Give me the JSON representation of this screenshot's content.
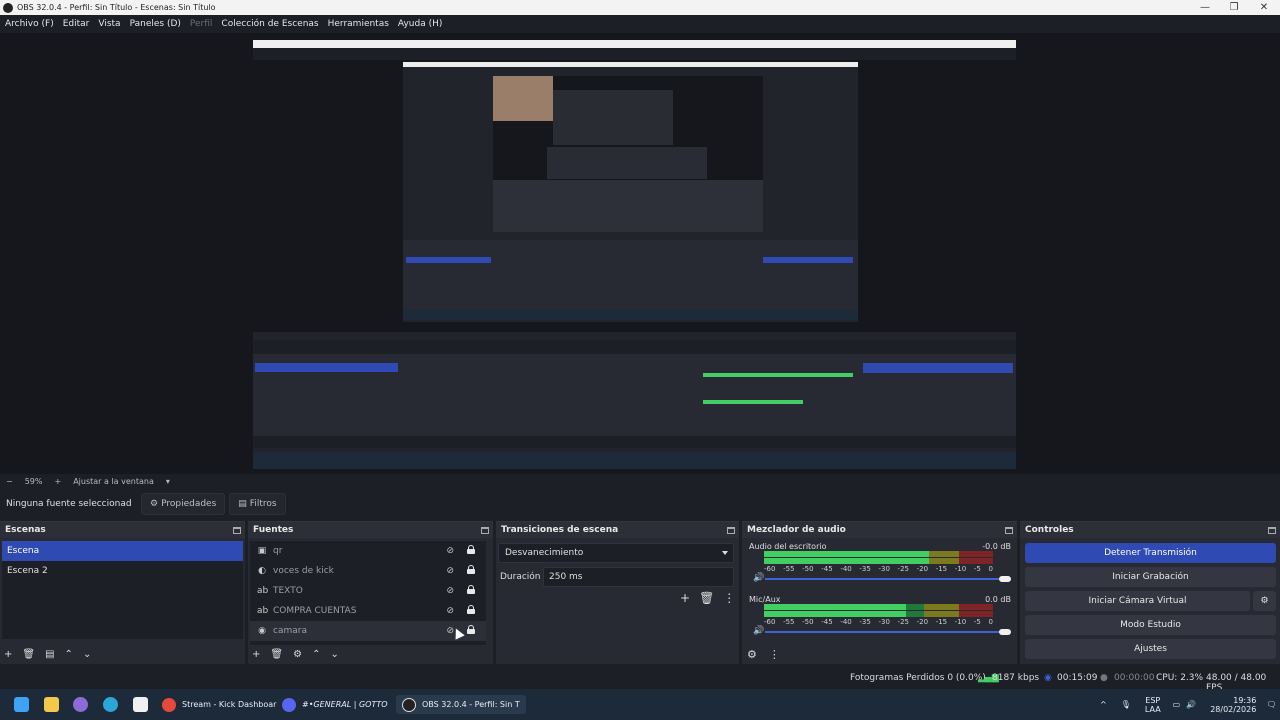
{
  "window": {
    "title": "OBS 32.0.4 - Perfil: Sin Título - Escenas: Sin Título"
  },
  "menu": [
    "Archivo (F)",
    "Editar",
    "Vista",
    "Paneles (D)",
    "Perfil",
    "Colección de Escenas",
    "Herramientas",
    "Ayuda (H)"
  ],
  "zoom": {
    "value": "59%",
    "fit_label": "Ajustar a la ventana"
  },
  "source_toolbar": {
    "no_selection": "Ninguna fuente seleccionad",
    "properties": "Propiedades",
    "filters": "Filtros"
  },
  "scenes": {
    "title": "Escenas",
    "items": [
      "Escena",
      "Escena 2"
    ],
    "selected": 0
  },
  "sources": {
    "title": "Fuentes",
    "items": [
      {
        "name": "qr",
        "icon": "image-icon"
      },
      {
        "name": "voces de kick",
        "icon": "browser-icon"
      },
      {
        "name": "TEXTO",
        "icon": "text-icon"
      },
      {
        "name": "COMPRA CUENTAS",
        "icon": "text-icon"
      },
      {
        "name": "camara",
        "icon": "camera-icon"
      }
    ]
  },
  "transitions": {
    "title": "Transiciones de escena",
    "selected": "Desvanecimiento",
    "duration_label": "Duración",
    "duration_value": "250 ms"
  },
  "mixer": {
    "title": "Mezclador de audio",
    "channels": [
      {
        "name": "Audio del escritorio",
        "db": "-0.0 dB",
        "level": 0.72
      },
      {
        "name": "Mic/Aux",
        "db": "0.0 dB",
        "level": 0.62
      }
    ],
    "ticks": [
      "-60",
      "-55",
      "-50",
      "-45",
      "-40",
      "-35",
      "-30",
      "-25",
      "-20",
      "-15",
      "-10",
      "-5",
      "0"
    ]
  },
  "controls": {
    "title": "Controles",
    "buttons": [
      "Detener Transmisión",
      "Iniciar Grabación",
      "Iniciar Cámara Virtual",
      "Modo Estudio",
      "Ajustes"
    ]
  },
  "status": {
    "dropped": "Fotogramas Perdidos 0 (0.0%)",
    "bitrate": "8187 kbps",
    "stream_time": "00:15:09",
    "rec_time": "00:00:00",
    "cpu": "CPU: 2.3%",
    "fps": "48.00 / 48.00 FPS"
  },
  "taskbar": {
    "apps": [
      "Stream - Kick Dashboar",
      "#•GENERAL | GOTTO",
      "OBS 32.0.4 - Perfil: Sin T"
    ],
    "lang": "ESP",
    "layout": "LAA",
    "time": "19:36",
    "date": "28/02/2026"
  }
}
